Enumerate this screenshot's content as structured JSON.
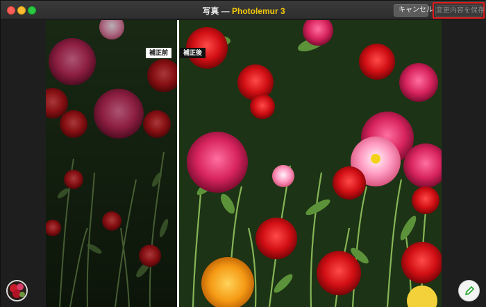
{
  "window": {
    "title_prefix": "写真 — ",
    "app_name": "Photolemur 3"
  },
  "toolbar": {
    "cancel_label": "キャンセル",
    "save_label": "変更内容を保存"
  },
  "comparison": {
    "before_label": "補正前",
    "after_label": "補正後"
  },
  "icons": {
    "edit": "brush-icon",
    "thumbnail": "photo-thumbnail-icon"
  },
  "colors": {
    "accent": "#f5c90a",
    "highlight": "#e01b1b"
  }
}
